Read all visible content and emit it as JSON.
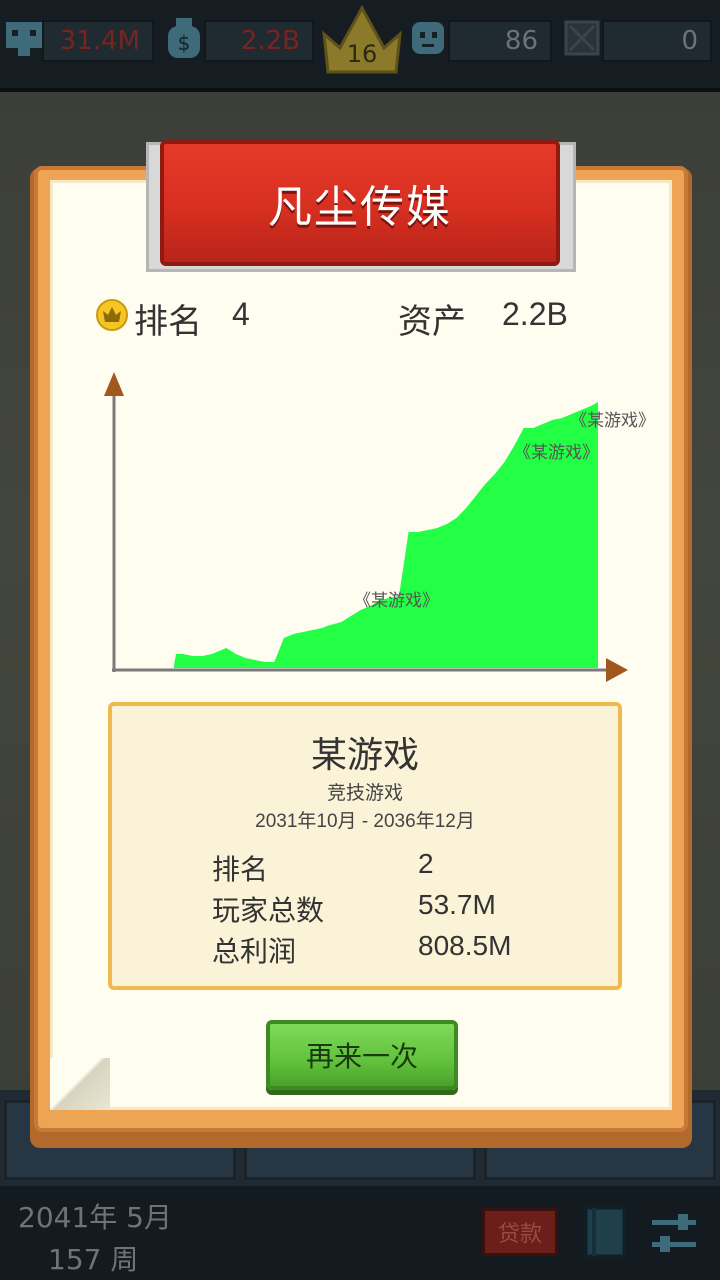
{
  "topbar": {
    "fans": "31.4M",
    "money": "2.2B",
    "level": "16",
    "staff": "86",
    "items": "0"
  },
  "company": {
    "name": "凡尘传媒",
    "rank_label": "排名",
    "rank_value": "4",
    "asset_label": "资产",
    "asset_value": "2.2B"
  },
  "chart_data": {
    "type": "area",
    "color": "#22ff44",
    "annotations": [
      "《某游戏》",
      "《某游戏》",
      "《某游戏》"
    ],
    "x": [
      0,
      8,
      16,
      24,
      32,
      40,
      48,
      50,
      56,
      64,
      72,
      80,
      88,
      92,
      100,
      108,
      116,
      124,
      132,
      140,
      148,
      156,
      164,
      172,
      176,
      182,
      188,
      196,
      204,
      212,
      220,
      228,
      236,
      244,
      252,
      260,
      268,
      276,
      284,
      292,
      300,
      308,
      316,
      324,
      332,
      340,
      348,
      356,
      364,
      372,
      380,
      388,
      396,
      402
    ],
    "values": [
      0,
      0,
      0,
      0,
      0,
      0,
      0,
      14,
      14,
      12,
      12,
      14,
      18,
      20,
      14,
      10,
      8,
      6,
      6,
      30,
      34,
      36,
      38,
      40,
      42,
      44,
      46,
      52,
      58,
      62,
      68,
      70,
      72,
      136,
      136,
      138,
      140,
      144,
      150,
      160,
      172,
      184,
      194,
      206,
      222,
      240,
      240,
      244,
      248,
      250,
      254,
      258,
      262,
      266
    ],
    "xlim": [
      0,
      402
    ],
    "ylim": [
      0,
      280
    ]
  },
  "game": {
    "name": "某游戏",
    "genre": "竞技游戏",
    "period": "2031年10月 - 2036年12月",
    "rows": [
      {
        "label": "排名",
        "value": "2"
      },
      {
        "label": "玩家总数",
        "value": "53.7M"
      },
      {
        "label": "总利润",
        "value": "808.5M"
      }
    ]
  },
  "retry_label": "再来一次",
  "bottombar": {
    "date": "2041年 5月",
    "week": "157 周",
    "loan_label": "贷款"
  },
  "colors": {
    "ribbon": "#d72f20",
    "chart_fill": "#22ff44",
    "button": "#62c23c",
    "frame": "#eea455"
  }
}
